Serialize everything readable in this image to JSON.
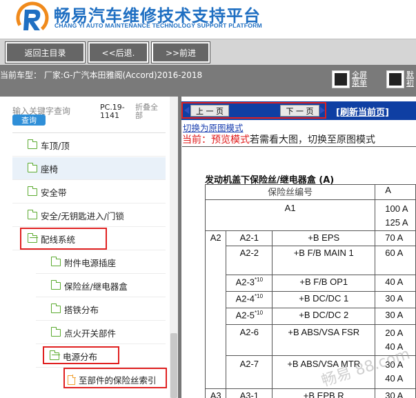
{
  "brand": {
    "title": "畅易汽车维修技术支持平台",
    "subtitle": "CHANG YI AUTO MAINTENANCE TECHNOLOGY SUPPORT PLATFORM"
  },
  "toolbar": {
    "home_label": "返回主目录",
    "back_label": "<<后退.",
    "forward_label": ">>前进"
  },
  "infobar": {
    "model_label": "当前车型：  厂家:G-广汽本田雅阁(Accord)2016-2018",
    "fullscreen_label": "全屏\n菜单",
    "default_label": "默\n初"
  },
  "left": {
    "search_placeholder": "输入关键字查询",
    "search_button": "查询",
    "pc_code": "PC.19-\n1141",
    "collapse_all": "折叠全\n部",
    "tree": [
      {
        "label": "车顶/顶"
      },
      {
        "label": "座椅"
      },
      {
        "label": "安全带"
      },
      {
        "label": "安全/无钥匙进入/门锁"
      },
      {
        "label": "配线系统"
      },
      {
        "label": "附件电源插座"
      },
      {
        "label": "保险丝/继电器盒"
      },
      {
        "label": "搭铁分布"
      },
      {
        "label": "点火开关部件"
      },
      {
        "label": "电源分布"
      },
      {
        "label": "至部件的保险丝索引"
      }
    ]
  },
  "right": {
    "prev_page": "上 一 页",
    "next_page": "下 一 页",
    "refresh": "[刷新当前页]",
    "switch_link": "切换为原图模式",
    "mode_prefix": "当前：",
    "mode_name": "预览模式",
    "mode_hint": "若需看大图，切换至原图模式",
    "doc_title": "发动机盖下保险丝/继电器盒 (A)",
    "table": {
      "header_fuse_no": "保险丝编号",
      "header_amp": "A",
      "a1_id": "A1",
      "a1_amp1": "100 A",
      "a1_amp2": "125 A",
      "grp_a2": "A2",
      "grp_a3": "A3",
      "rows": [
        {
          "id": "A2-1",
          "sup": "",
          "name": "+B EPS",
          "amp": "70 A"
        },
        {
          "id": "A2-2",
          "sup": "",
          "name": "+B F/B MAIN 1",
          "amp": "60 A"
        },
        {
          "id": "A2-3",
          "sup": "*10",
          "name": "+B F/B OP1",
          "amp": "40 A"
        },
        {
          "id": "A2-4",
          "sup": "*10",
          "name": "+B DC/DC 1",
          "amp": "30 A"
        },
        {
          "id": "A2-5",
          "sup": "*10",
          "name": "+B DC/DC 2",
          "amp": "30 A"
        },
        {
          "id": "A2-6",
          "sup": "",
          "name": "+B ABS/VSA FSR",
          "amp": "20 A",
          "amp2": "40 A"
        },
        {
          "id": "A2-7",
          "sup": "",
          "name": "+B ABS/VSA MTR",
          "amp": "30 A",
          "amp2": "40 A"
        },
        {
          "id": "A3-1",
          "sup": "",
          "name": "+B EPB R",
          "amp": "30 A"
        }
      ]
    },
    "watermark": "畅易 88.com"
  },
  "colors": {
    "brand_blue": "#1f6fc2",
    "nav_blue": "#0f3fa3",
    "highlight_red": "#e02020",
    "folder_green": "#5aaa2e"
  }
}
